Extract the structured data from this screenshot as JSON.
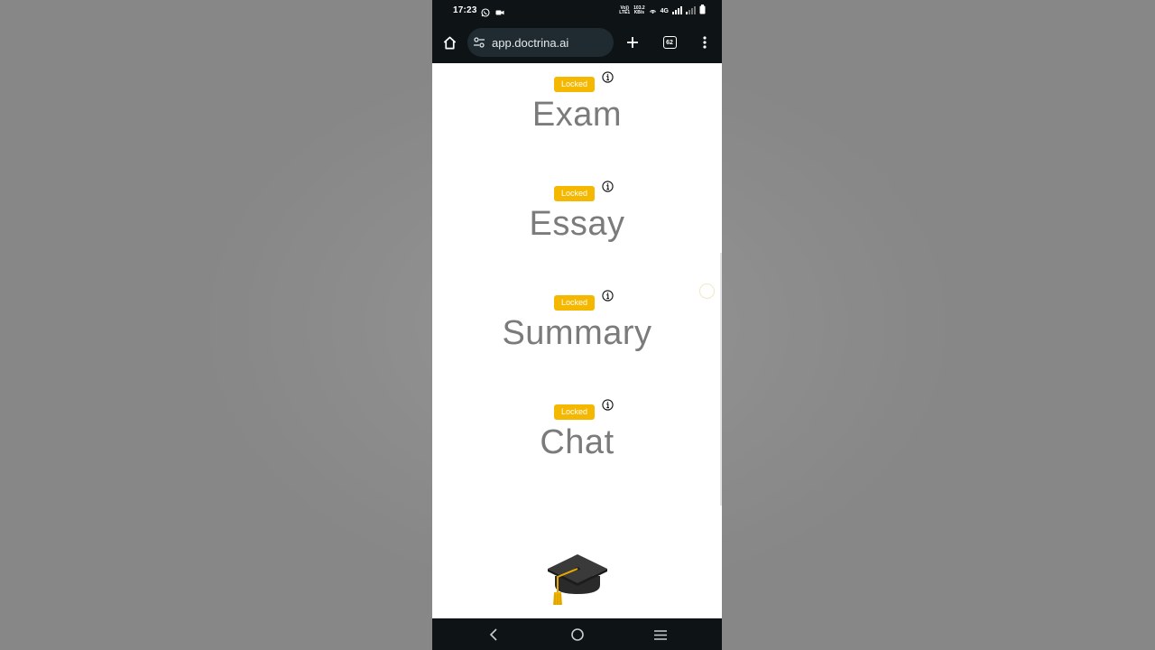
{
  "status_bar": {
    "time": "17:23",
    "left_icons": [
      "whatsapp-icon",
      "video-icon"
    ],
    "volte_top": "Vo))",
    "volte_bottom": "LTE1",
    "speed_value": "103.2",
    "speed_unit": "KB/s",
    "network": "4G"
  },
  "browser": {
    "url": "app.doctrina.ai",
    "tab_count": "62",
    "icons": [
      "home-icon",
      "site-settings-icon",
      "plus-icon",
      "tab-switcher-icon",
      "more-vert-icon"
    ]
  },
  "features": [
    {
      "badge": "Locked",
      "title": "Exam"
    },
    {
      "badge": "Locked",
      "title": "Essay"
    },
    {
      "badge": "Locked",
      "title": "Summary"
    },
    {
      "badge": "Locked",
      "title": "Chat"
    }
  ],
  "colors": {
    "badge": "#f5b800",
    "title_text": "#7b7b7b",
    "system_bar": "#0e1416",
    "url_pill": "#1f2b30"
  },
  "decorations": {
    "footer_icon": "graduation-cap-icon"
  },
  "nav_bar": {
    "icons": [
      "back-icon",
      "home-circle-icon",
      "recents-icon"
    ]
  }
}
